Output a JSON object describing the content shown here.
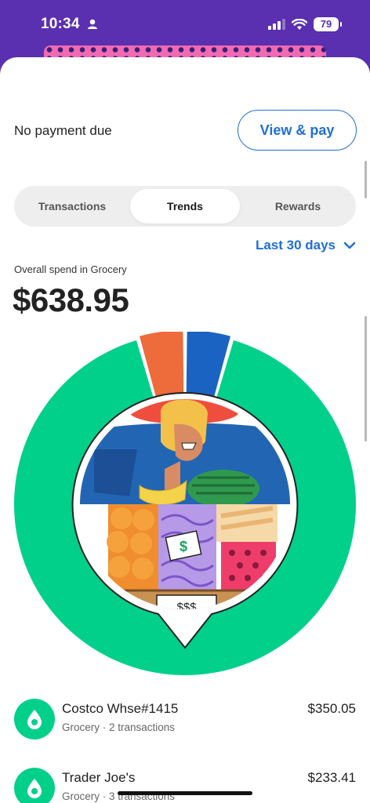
{
  "status_bar": {
    "time": "10:34",
    "battery": "79"
  },
  "header": {
    "payment_status": "No payment due",
    "view_pay_label": "View & pay"
  },
  "tabs": [
    {
      "label": "Transactions",
      "active": false
    },
    {
      "label": "Trends",
      "active": true
    },
    {
      "label": "Rewards",
      "active": false
    }
  ],
  "range": {
    "label": "Last 30 days"
  },
  "summary": {
    "label": "Overall spend in Grocery",
    "amount": "$638.95"
  },
  "breakdown": {
    "segments": [
      {
        "merchant": "Costco Whse#1415 + Trader Joe's",
        "share": 0.912,
        "color": "#00d08a"
      },
      {
        "merchant": "Other merchant",
        "share": 0.044,
        "color": "#ee6b3b"
      },
      {
        "merchant": "Other merchant",
        "share": 0.044,
        "color": "#1a63c2"
      }
    ]
  },
  "merchants": [
    {
      "name": "Costco Whse#1415",
      "meta": "Grocery · 2 transactions",
      "amount": "$350.05",
      "icon": "avocado-icon"
    },
    {
      "name": "Trader Joe's",
      "meta": "Grocery · 3 transactions",
      "amount": "$233.41",
      "icon": "avocado-icon"
    }
  ],
  "colors": {
    "accent": "#1f6fd6",
    "brand": "#5a2fb0",
    "grocery": "#00d08a"
  }
}
